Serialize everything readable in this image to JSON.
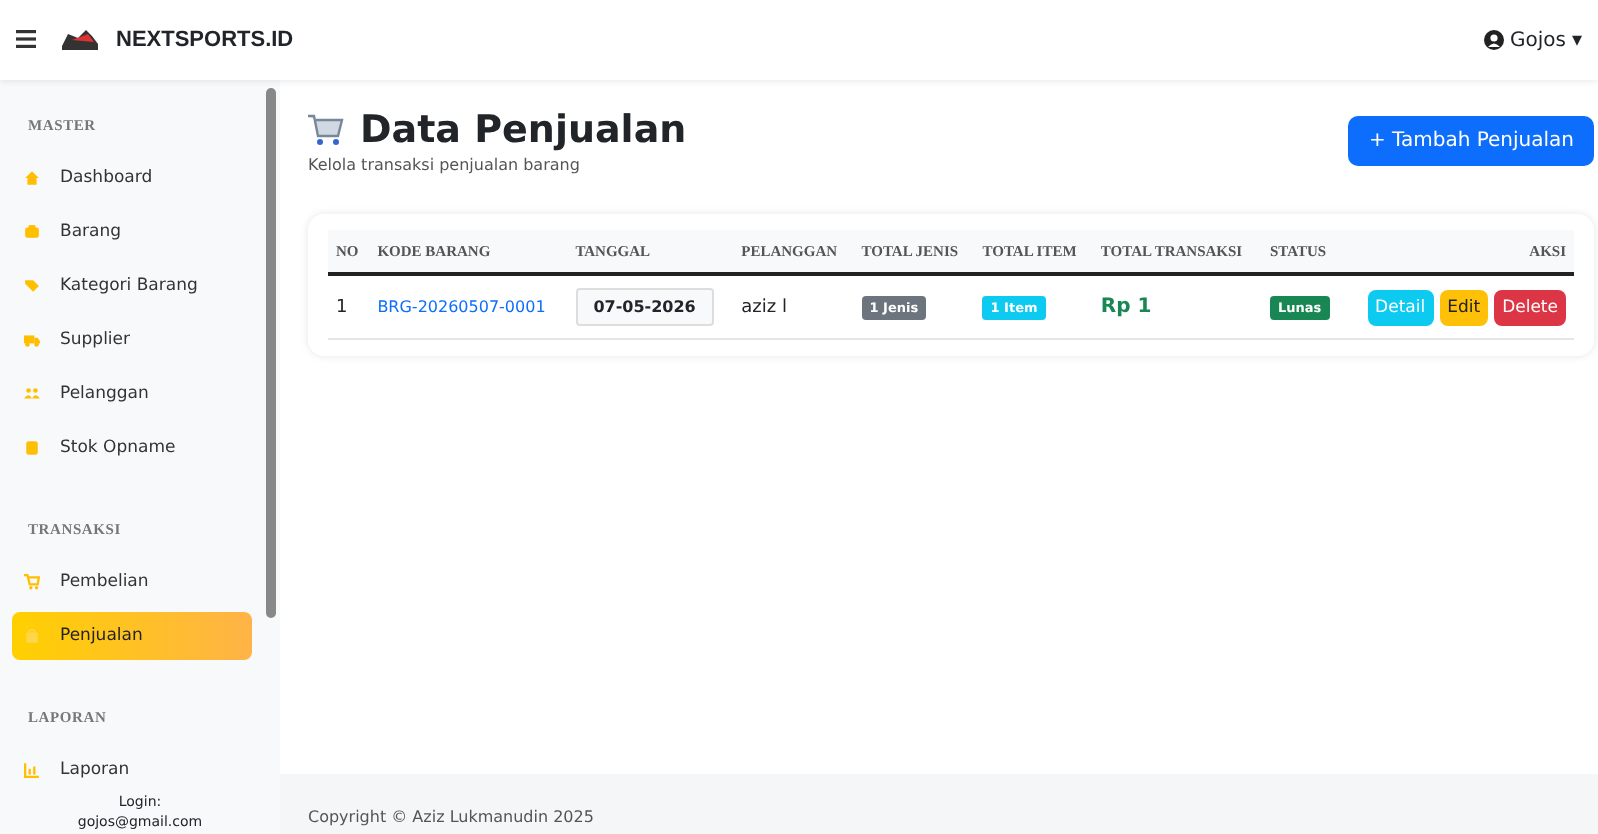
{
  "navbar": {
    "brand": "NEXTSPORTS.ID",
    "user": "Gojos",
    "caret": "▾"
  },
  "sidebar": {
    "sections": [
      {
        "title": "MASTER",
        "items": [
          {
            "label": "Dashboard",
            "selected": false
          },
          {
            "label": "Barang",
            "selected": false
          },
          {
            "label": "Kategori Barang",
            "selected": false
          },
          {
            "label": "Supplier",
            "selected": false
          },
          {
            "label": "Pelanggan",
            "selected": false
          },
          {
            "label": "Stok Opname",
            "selected": false
          }
        ]
      },
      {
        "title": "TRANSAKSI",
        "items": [
          {
            "label": "Pembelian",
            "selected": false
          },
          {
            "label": "Penjualan",
            "selected": true
          }
        ]
      },
      {
        "title": "LAPORAN",
        "items": [
          {
            "label": "Laporan",
            "selected": false
          }
        ]
      }
    ],
    "login_label": "Login:",
    "login_email": "gojos@gmail.com"
  },
  "page": {
    "title": "Data Penjualan",
    "subtitle": "Kelola transaksi penjualan barang",
    "add_button": "+ Tambah Penjualan"
  },
  "table": {
    "columns": [
      "NO",
      "KODE BARANG",
      "TANGGAL",
      "PELANGGAN",
      "TOTAL JENIS",
      "TOTAL ITEM",
      "TOTAL TRANSAKSI",
      "STATUS",
      "AKSI"
    ],
    "rows": [
      {
        "cells": [
          {
            "kind": "text",
            "text": "1"
          },
          {
            "kind": "link",
            "text": "BRG-20260507-0001"
          },
          {
            "kind": "date",
            "text": "07-05-2026"
          },
          {
            "kind": "text",
            "text": "aziz l"
          },
          {
            "kind": "badge",
            "text": "1 Jenis",
            "color": "#6c757d"
          },
          {
            "kind": "badge",
            "text": "1 Item",
            "color": "#0dcaf0"
          },
          {
            "kind": "amount",
            "text": "Rp 1"
          },
          {
            "kind": "badge",
            "text": "Lunas",
            "color": "#198754"
          },
          {
            "kind": "actions",
            "buttons": [
              {
                "label": "Detail",
                "color": "#0dcaf0"
              },
              {
                "label": "Edit",
                "color": "#ffc107"
              },
              {
                "label": "Delete",
                "color": "#dc3545"
              }
            ]
          }
        ]
      }
    ]
  },
  "footer": "Copyright © Aziz Lukmanudin 2025"
}
